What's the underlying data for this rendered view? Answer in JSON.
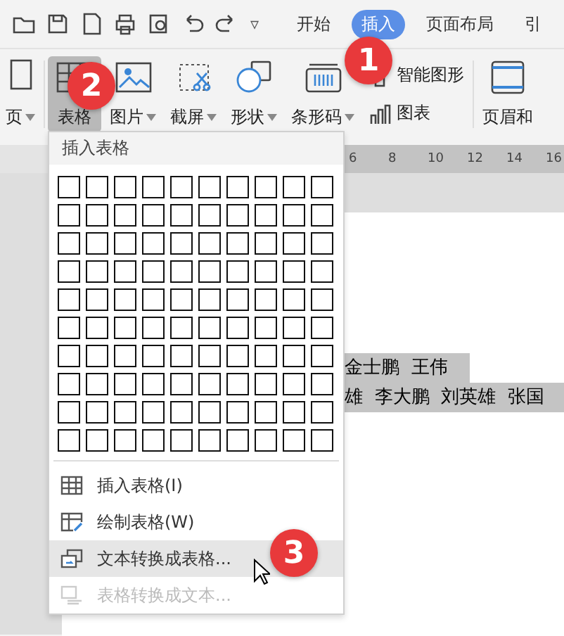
{
  "quick_access": {
    "more": "▿"
  },
  "tabs": [
    {
      "label": "开始",
      "selected": false
    },
    {
      "label": "插入",
      "selected": true
    },
    {
      "label": "页面布局",
      "selected": false
    },
    {
      "label": "引",
      "selected": false
    }
  ],
  "ribbon": {
    "large": [
      {
        "label": "页",
        "kind": "page",
        "dropdown": true,
        "selected": false
      },
      {
        "label": "表格",
        "kind": "table",
        "dropdown": false,
        "selected": true
      },
      {
        "label": "图片",
        "kind": "image",
        "dropdown": true,
        "selected": false
      },
      {
        "label": "截屏",
        "kind": "screenshot",
        "dropdown": true,
        "selected": false
      },
      {
        "label": "形状",
        "kind": "shapes",
        "dropdown": true,
        "selected": false
      },
      {
        "label": "条形码",
        "kind": "barcode",
        "dropdown": true,
        "selected": false
      }
    ],
    "small": [
      {
        "label": "智能图形",
        "kind": "smart"
      },
      {
        "label": "图表",
        "kind": "chart"
      }
    ],
    "trailing": {
      "label": "页眉和",
      "kind": "header"
    }
  },
  "ruler": {
    "ticks": [
      "6",
      "8",
      "10",
      "12",
      "14",
      "16"
    ]
  },
  "document": {
    "lines": [
      "金士鹏  王伟",
      "雄  李大鹏  刘英雄  张国"
    ]
  },
  "menu": {
    "header": "插入表格",
    "items": [
      {
        "label": "插入表格(I)",
        "kind": "insert",
        "selected": false,
        "disabled": false
      },
      {
        "label": "绘制表格(W)",
        "kind": "draw",
        "selected": false,
        "disabled": false
      },
      {
        "label": "文本转换成表格...",
        "kind": "text-to-table",
        "selected": true,
        "disabled": false
      },
      {
        "label": "表格转换成文本...",
        "kind": "table-to-text",
        "selected": false,
        "disabled": true
      }
    ]
  },
  "badges": [
    {
      "label": "1"
    },
    {
      "label": "2"
    },
    {
      "label": "3"
    }
  ]
}
